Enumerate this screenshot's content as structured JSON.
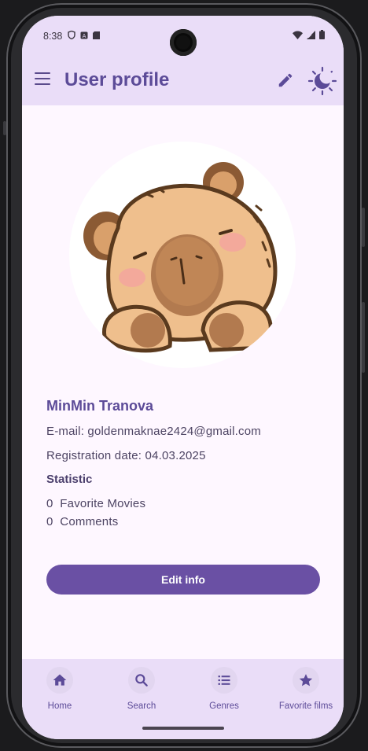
{
  "status_bar": {
    "time": "8:38"
  },
  "app_bar": {
    "title": "User profile",
    "menu_icon": "menu-icon",
    "edit_icon": "edit-icon",
    "theme_icon": "dark-mode-icon"
  },
  "profile": {
    "name": "MinMin Tranova",
    "email_line": "E-mail: goldenmaknae2424@gmail.com",
    "registration_line": "Registration date: 04.03.2025",
    "statistic_title": "Statistic",
    "stats": [
      {
        "count": "0",
        "label": "Favorite Movies"
      },
      {
        "count": "0",
        "label": "Comments"
      }
    ]
  },
  "edit_button": {
    "label": "Edit info"
  },
  "bottom_nav": {
    "items": [
      {
        "label": "Home",
        "icon": "home-icon"
      },
      {
        "label": "Search",
        "icon": "search-icon"
      },
      {
        "label": "Genres",
        "icon": "list-icon"
      },
      {
        "label": "Favorite films",
        "icon": "star-icon"
      }
    ]
  },
  "colors": {
    "primary": "#6a50a4",
    "title": "#5c4b98",
    "app_bar_bg": "#eaddf8",
    "background": "#fef7ff"
  }
}
